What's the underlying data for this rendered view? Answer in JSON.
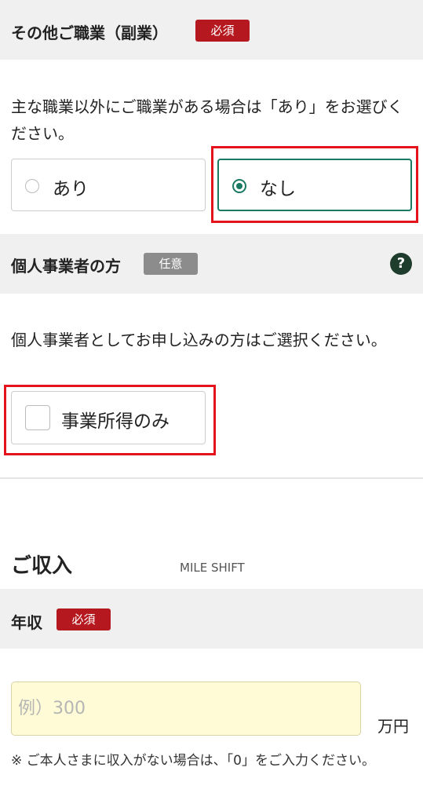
{
  "side_job": {
    "title": "その他ご職業（副業）",
    "badge": "必須",
    "description": "主な職業以外にご職業がある場合は「あり」をお選びください。",
    "options": [
      {
        "label": "あり",
        "selected": false
      },
      {
        "label": "なし",
        "selected": true
      }
    ]
  },
  "sole_proprietor": {
    "title": "個人事業者の方",
    "badge": "任意",
    "help_icon": "?",
    "description": "個人事業者としてお申し込みの方はご選択ください。",
    "checkbox_label": "事業所得のみ",
    "checked": false
  },
  "income_section": {
    "heading": "ご収入",
    "watermark": "MILE SHIFT"
  },
  "annual_income": {
    "title": "年収",
    "badge": "必須",
    "placeholder": "例）300",
    "value": "",
    "unit": "万円",
    "note": "※ ご本人さまに収入がない場合は、「0」をご入力ください。"
  },
  "colors": {
    "accent_green": "#1a7a63",
    "required_red": "#b5191f",
    "highlight_red": "#e3141b",
    "input_yellow": "#fffbd6"
  }
}
